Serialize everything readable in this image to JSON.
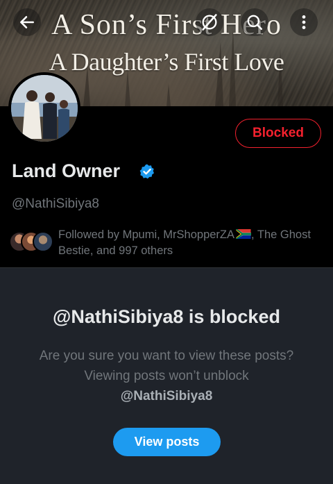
{
  "banner": {
    "line1": "A Son’s First Hero",
    "line2": "A Daughter’s First Love"
  },
  "topbar": {
    "back_icon": "arrow-left-icon",
    "grok_icon": "grok-icon",
    "search_icon": "search-icon",
    "more_icon": "more-vertical-icon"
  },
  "profile": {
    "display_name": "Land Owner",
    "handle": "@NathiSibiya8",
    "verified": true,
    "blocked_label": "Blocked",
    "followed_by": "Followed by Mpumi, MrShopperZA",
    "followed_by_rest": ", The Ghost Bestie, and 997 others"
  },
  "blocked_panel": {
    "title": "@NathiSibiya8 is blocked",
    "body": "Are you sure you want to view these posts? Viewing posts won’t unblock",
    "body_handle": "@NathiSibiya8",
    "button_label": "View posts"
  },
  "colors": {
    "accent": "#1d9bf0",
    "danger": "#f4212e",
    "panel_bg": "#1f232a"
  }
}
